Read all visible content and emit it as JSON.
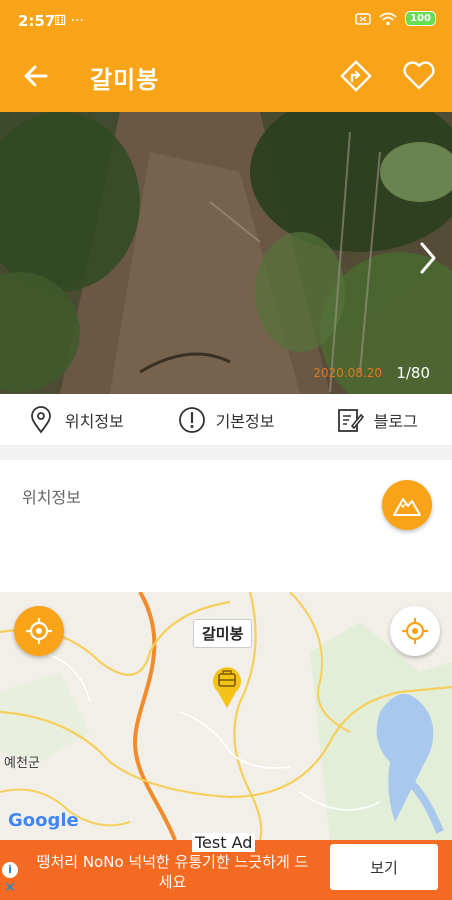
{
  "status_bar": {
    "time": "2:57",
    "icons_left": "⚅ ···",
    "battery": "100"
  },
  "app_bar": {
    "title": "갈미봉",
    "accent_color": "#f8a318"
  },
  "photo": {
    "date_stamp": "2020.08.20",
    "counter": "1/80"
  },
  "tabs": [
    {
      "label": "위치정보",
      "icon": "location-pin-icon"
    },
    {
      "label": "기본정보",
      "icon": "info-exclamation-icon"
    },
    {
      "label": "블로그",
      "icon": "blog-edit-icon"
    }
  ],
  "section": {
    "title": "위치정보"
  },
  "map": {
    "peak_label": "갈미봉",
    "town_label": "예천군",
    "attribution": "Google"
  },
  "ad": {
    "label": "Test Ad",
    "text": "땡처리 NoNo 넉넉한 유통기한 느긋하게 드세요",
    "button_label": "보기",
    "info_icon": "i",
    "close_icon": "✕"
  }
}
